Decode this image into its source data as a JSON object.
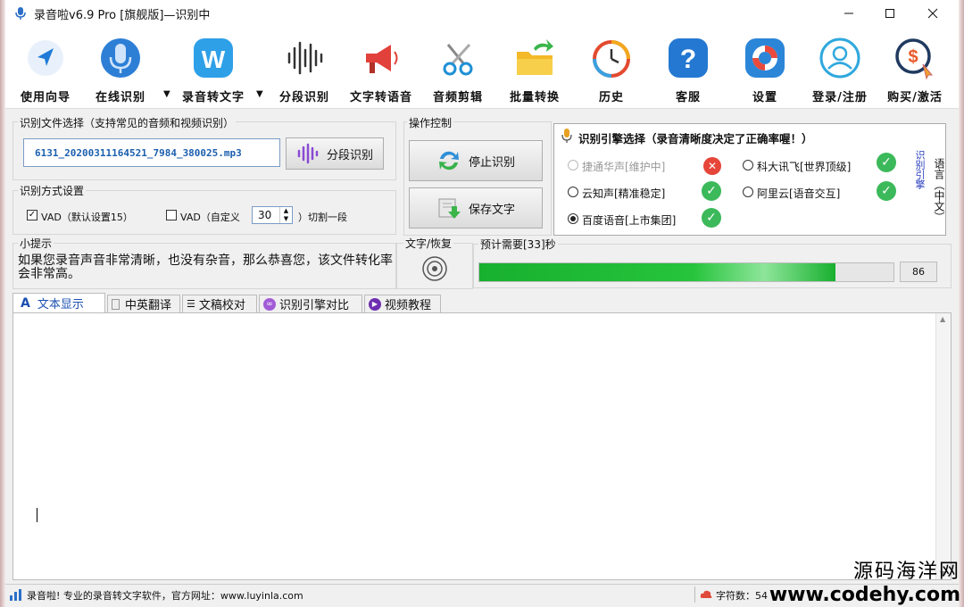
{
  "window": {
    "title": "录音啦v6.9 Pro [旗舰版]—识别中"
  },
  "toolbar": {
    "items": [
      {
        "label": "使用向导",
        "icon": "navigation-arrow-icon"
      },
      {
        "label": "在线识别",
        "icon": "microphone-icon"
      },
      {
        "label": "录音转文字",
        "icon": "w-logo-icon"
      },
      {
        "label": "分段识别",
        "icon": "waveform-icon"
      },
      {
        "label": "文字转语音",
        "icon": "megaphone-icon"
      },
      {
        "label": "音频剪辑",
        "icon": "scissors-icon"
      },
      {
        "label": "批量转换",
        "icon": "folder-convert-icon"
      },
      {
        "label": "历史",
        "icon": "history-clock-icon"
      },
      {
        "label": "客服",
        "icon": "help-icon"
      },
      {
        "label": "设置",
        "icon": "lifebuoy-settings-icon"
      },
      {
        "label": "登录/注册",
        "icon": "user-icon"
      },
      {
        "label": "购买/激活",
        "icon": "purchase-icon"
      }
    ]
  },
  "file_select": {
    "title": "识别文件选择（支持常见的音频和视频识别）",
    "filename": "6131_20200311164521_7984_380025.mp3",
    "segment_button": "分段识别"
  },
  "recognition_mode": {
    "title": "识别方式设置",
    "vad_default_label": "VAD（默认设置15）",
    "vad_default_checked": true,
    "vad_custom_label": "VAD（自定义",
    "vad_custom_checked": false,
    "vad_custom_value": "30",
    "vad_suffix": "）切割一段"
  },
  "tips": {
    "title": "小提示",
    "text": "如果您录音声音非常清晰，也没有杂音，那么恭喜您，该文件转化率会非常高。"
  },
  "operation": {
    "title": "操作控制",
    "stop_button": "停止识别",
    "save_button": "保存文字"
  },
  "text_recover": {
    "title": "文字/恢复"
  },
  "engine": {
    "title": "识别引擎选择（录音清晰度决定了正确率喔！）",
    "options": [
      {
        "label": "捷通华声[维护中]",
        "selected": false,
        "disabled": true,
        "status": "error"
      },
      {
        "label": "科大讯飞[世界顶级]",
        "selected": false,
        "disabled": false,
        "status": "ok"
      },
      {
        "label": "云知声[精准稳定]",
        "selected": false,
        "disabled": false,
        "status": "ok"
      },
      {
        "label": "阿里云[语音交互]",
        "selected": false,
        "disabled": false,
        "status": "ok"
      },
      {
        "label": "百度语音[上市集团]",
        "selected": true,
        "disabled": false,
        "status": "ok"
      }
    ],
    "side_tab_language": "语言（中文）",
    "side_tab_engine": "识别引擎"
  },
  "progress": {
    "title": "预计需要[33]秒",
    "percent": 86,
    "value_label": "86"
  },
  "tabs": [
    {
      "label": "文本显示",
      "active": true,
      "icon": "text-a-icon"
    },
    {
      "label": "中英翻译",
      "active": false,
      "icon": "document-icon"
    },
    {
      "label": "文稿校对",
      "active": false,
      "icon": "list-icon"
    },
    {
      "label": "识别引擎对比",
      "active": false,
      "icon": "compare-icon"
    },
    {
      "label": "视频教程",
      "active": false,
      "icon": "play-icon"
    }
  ],
  "statusbar": {
    "left_text": "录音啦! 专业的录音转文字软件，官方网址：www.luyinla.com",
    "char_count_label": "字符数：54"
  },
  "watermark": {
    "line1": "源码海洋网",
    "line2": "www.codehy.com"
  },
  "colors": {
    "accent_blue": "#1b5fae",
    "progress_green": "#1fb53a",
    "ok_green": "#3cb95a",
    "error_red": "#e6453a"
  }
}
